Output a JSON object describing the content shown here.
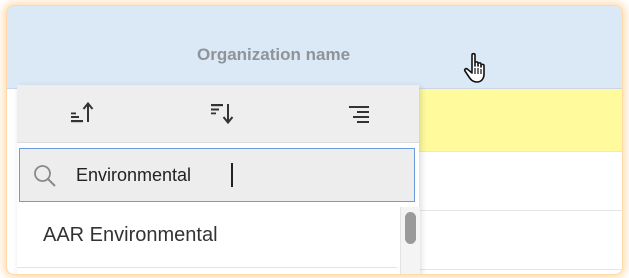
{
  "column_header": {
    "title": "Organization name"
  },
  "sort_toolbar": {
    "icons": [
      "sort-ascending-icon",
      "sort-descending-icon",
      "align-right-lines-icon"
    ]
  },
  "search": {
    "value": "Environmental",
    "icon": "search-icon"
  },
  "results": {
    "items": [
      {
        "label": "AAR Environmental"
      }
    ]
  },
  "colors": {
    "header_bg": "#dbe8f5",
    "highlight_row": "#fffb9c",
    "frame_glow": "#ffc882",
    "search_border": "#6e9be0"
  }
}
